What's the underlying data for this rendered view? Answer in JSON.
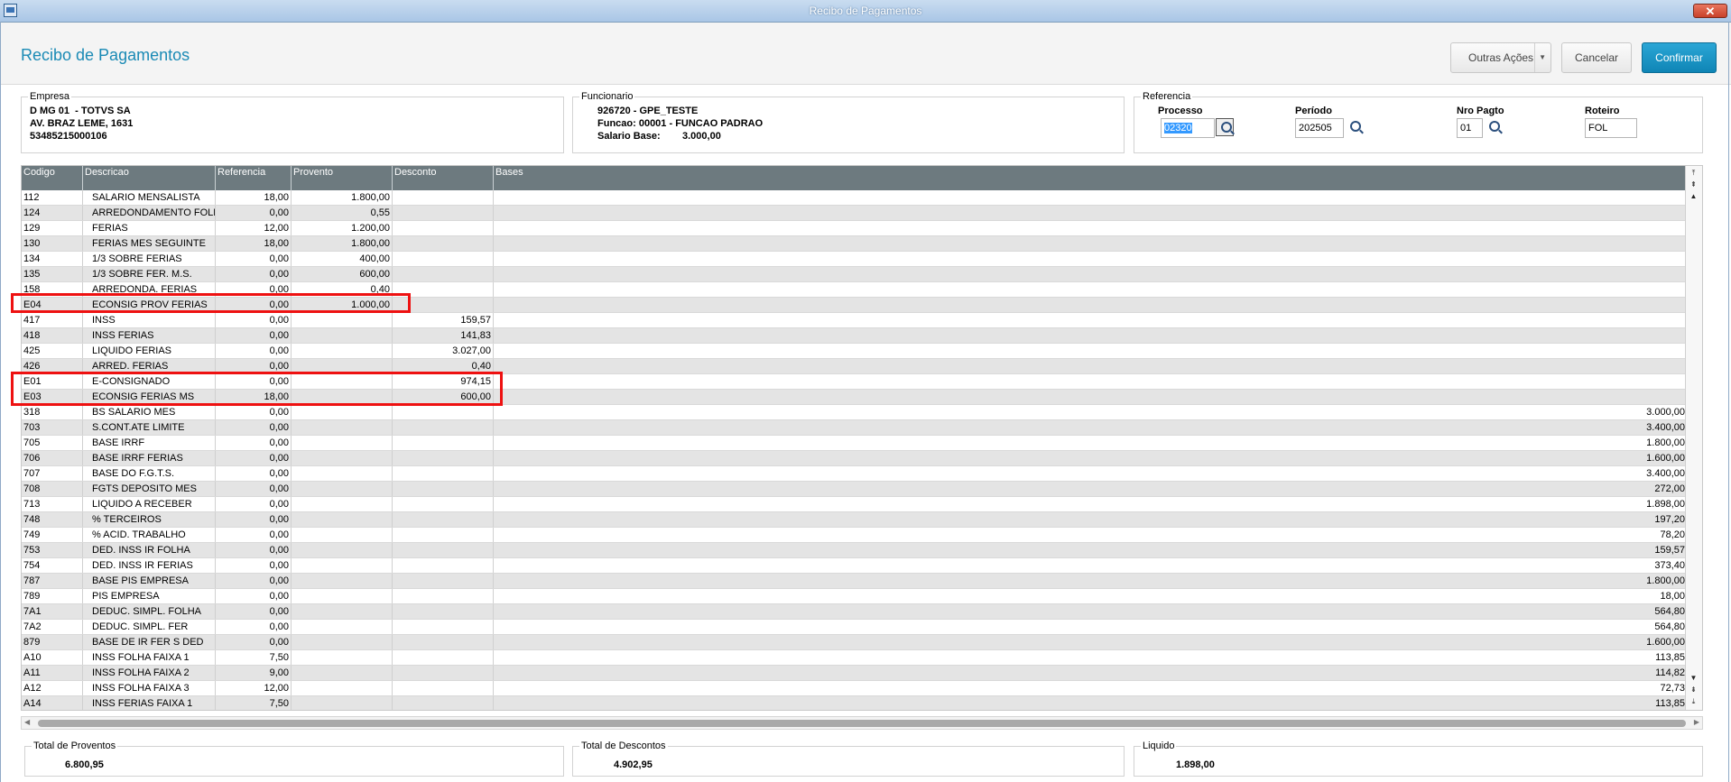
{
  "window": {
    "title": "Recibo de Pagamentos"
  },
  "header": {
    "page_title": "Recibo de Pagamentos",
    "outras_acoes": "Outras Ações",
    "cancelar": "Cancelar",
    "confirmar": "Confirmar"
  },
  "empresa": {
    "label": "Empresa",
    "line1": "D MG 01  - TOTVS SA",
    "line2": "AV. BRAZ LEME, 1631",
    "line3": "53485215000106"
  },
  "funcionario": {
    "label": "Funcionario",
    "line1": "926720 - GPE_TESTE",
    "line2": "Funcao: 00001 - FUNCAO PADRAO",
    "salario_label": "Salario Base:",
    "salario_value": "3.000,00"
  },
  "referencia": {
    "label": "Referencia",
    "processo_label": "Processo",
    "processo_value": "02320",
    "periodo_label": "Período",
    "periodo_value": "202505",
    "nro_pagto_label": "Nro Pagto",
    "nro_pagto_value": "01",
    "roteiro_label": "Roteiro",
    "roteiro_value": "FOL"
  },
  "grid": {
    "columns": [
      "Codigo",
      "Descricao",
      "Referencia",
      "Provento",
      "Desconto",
      "Bases"
    ],
    "rows": [
      [
        "112",
        "SALARIO MENSALISTA",
        "18,00",
        "1.800,00",
        "",
        ""
      ],
      [
        "124",
        "ARREDONDAMENTO FOLHA",
        "0,00",
        "0,55",
        "",
        ""
      ],
      [
        "129",
        "FERIAS",
        "12,00",
        "1.200,00",
        "",
        ""
      ],
      [
        "130",
        "FERIAS MES SEGUINTE",
        "18,00",
        "1.800,00",
        "",
        ""
      ],
      [
        "134",
        "1/3 SOBRE FERIAS",
        "0,00",
        "400,00",
        "",
        ""
      ],
      [
        "135",
        "1/3 SOBRE FER. M.S.",
        "0,00",
        "600,00",
        "",
        ""
      ],
      [
        "158",
        "ARREDONDA. FERIAS",
        "0,00",
        "0,40",
        "",
        ""
      ],
      [
        "E04",
        "ECONSIG PROV FERIAS",
        "0,00",
        "1.000,00",
        "",
        ""
      ],
      [
        "417",
        "INSS",
        "0,00",
        "",
        "159,57",
        ""
      ],
      [
        "418",
        "INSS FERIAS",
        "0,00",
        "",
        "141,83",
        ""
      ],
      [
        "425",
        "LIQUIDO FERIAS",
        "0,00",
        "",
        "3.027,00",
        ""
      ],
      [
        "426",
        "ARRED. FERIAS",
        "0,00",
        "",
        "0,40",
        ""
      ],
      [
        "E01",
        "E-CONSIGNADO",
        "0,00",
        "",
        "974,15",
        ""
      ],
      [
        "E03",
        "ECONSIG FERIAS MS",
        "18,00",
        "",
        "600,00",
        ""
      ],
      [
        "318",
        "BS SALARIO MES",
        "0,00",
        "",
        "",
        "3.000,00"
      ],
      [
        "703",
        "S.CONT.ATE LIMITE",
        "0,00",
        "",
        "",
        "3.400,00"
      ],
      [
        "705",
        "BASE IRRF",
        "0,00",
        "",
        "",
        "1.800,00"
      ],
      [
        "706",
        "BASE IRRF FERIAS",
        "0,00",
        "",
        "",
        "1.600,00"
      ],
      [
        "707",
        "BASE DO F.G.T.S.",
        "0,00",
        "",
        "",
        "3.400,00"
      ],
      [
        "708",
        "FGTS DEPOSITO MES",
        "0,00",
        "",
        "",
        "272,00"
      ],
      [
        "713",
        "LIQUIDO A RECEBER",
        "0,00",
        "",
        "",
        "1.898,00"
      ],
      [
        "748",
        "% TERCEIROS",
        "0,00",
        "",
        "",
        "197,20"
      ],
      [
        "749",
        "% ACID. TRABALHO",
        "0,00",
        "",
        "",
        "78,20"
      ],
      [
        "753",
        "DED. INSS IR FOLHA",
        "0,00",
        "",
        "",
        "159,57"
      ],
      [
        "754",
        "DED. INSS IR FERIAS",
        "0,00",
        "",
        "",
        "373,40"
      ],
      [
        "787",
        "BASE PIS EMPRESA",
        "0,00",
        "",
        "",
        "1.800,00"
      ],
      [
        "789",
        "PIS EMPRESA",
        "0,00",
        "",
        "",
        "18,00"
      ],
      [
        "7A1",
        "DEDUC. SIMPL. FOLHA",
        "0,00",
        "",
        "",
        "564,80"
      ],
      [
        "7A2",
        "DEDUC. SIMPL. FER",
        "0,00",
        "",
        "",
        "564,80"
      ],
      [
        "879",
        "BASE DE IR FER S DED",
        "0,00",
        "",
        "",
        "1.600,00"
      ],
      [
        "A10",
        "INSS FOLHA FAIXA 1",
        "7,50",
        "",
        "",
        "113,85"
      ],
      [
        "A11",
        "INSS FOLHA FAIXA 2",
        "9,00",
        "",
        "",
        "114,82"
      ],
      [
        "A12",
        "INSS FOLHA FAIXA 3",
        "12,00",
        "",
        "",
        "72,73"
      ],
      [
        "A14",
        "INSS FERIAS FAIXA 1",
        "7,50",
        "",
        "",
        "113,85"
      ]
    ]
  },
  "totals": {
    "proventos_label": "Total de Proventos",
    "proventos_value": "6.800,95",
    "descontos_label": "Total de Descontos",
    "descontos_value": "4.902,95",
    "liquido_label": "Liquido",
    "liquido_value": "1.898,00"
  }
}
